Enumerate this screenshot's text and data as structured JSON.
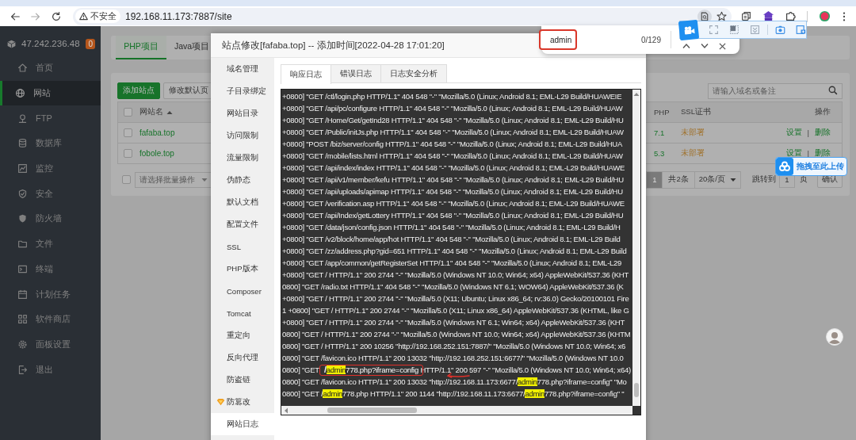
{
  "browser": {
    "security_label": "不安全",
    "url": "192.168.11.173:7887/site"
  },
  "find_bar": {
    "query": "admin",
    "annotated": true,
    "count": "0/129"
  },
  "sidebar": {
    "server": "47.242.236.48",
    "badge": "0",
    "items": [
      {
        "label": "首页",
        "selected": false
      },
      {
        "label": "网站",
        "selected": true
      },
      {
        "label": "FTP",
        "selected": false
      },
      {
        "label": "数据库",
        "selected": false
      },
      {
        "label": "监控",
        "selected": false
      },
      {
        "label": "安全",
        "selected": false
      },
      {
        "label": "防火墙",
        "selected": false
      },
      {
        "label": "文件",
        "selected": false
      },
      {
        "label": "终端",
        "selected": false
      },
      {
        "label": "计划任务",
        "selected": false
      },
      {
        "label": "软件商店",
        "selected": false
      },
      {
        "label": "面板设置",
        "selected": false
      },
      {
        "label": "退出",
        "selected": false
      }
    ]
  },
  "site_list": {
    "tabs": [
      {
        "label": "PHP项目",
        "selected": true
      },
      {
        "label": "Java项目",
        "selected": false
      }
    ],
    "buttons": [
      {
        "label": "添加站点",
        "kind": "primary"
      },
      {
        "label": "修改默认页",
        "kind": "default"
      }
    ],
    "search": {
      "placeholder": "请输入域名或备注"
    },
    "table": {
      "all_checked": false,
      "columns": [
        "网站名",
        "PHP",
        "SSL证书",
        "操作"
      ],
      "rows": [
        {
          "checked": false,
          "name": "fafaba.top",
          "php": "7.1",
          "ssl": "未部署",
          "actions": [
            "设置",
            "删除"
          ],
          "separator": "|"
        },
        {
          "checked": false,
          "name": "fobole.top",
          "php": "5.3",
          "ssl": "未部署",
          "actions": [
            "设置",
            "删除"
          ],
          "separator": "|"
        }
      ]
    },
    "batch": {
      "checked": false,
      "placeholder": "请选择批量操作"
    },
    "pagination": {
      "pages": [
        {
          "label": "1",
          "selected": true
        }
      ],
      "total": "共2条",
      "page_size": "20条/页",
      "jump_label": "跳转到",
      "jump_value": "1",
      "unit": "页",
      "confirm": "确认"
    }
  },
  "dialog": {
    "title": "站点修改[fafaba.top] -- 添加时间[2022-04-28 17:01:20]",
    "menu": [
      {
        "label": "域名管理",
        "premium": false,
        "selected": false
      },
      {
        "label": "子目录绑定",
        "premium": false,
        "selected": false
      },
      {
        "label": "网站目录",
        "premium": false,
        "selected": false
      },
      {
        "label": "访问限制",
        "premium": false,
        "selected": false
      },
      {
        "label": "流量限制",
        "premium": false,
        "selected": false
      },
      {
        "label": "伪静态",
        "premium": false,
        "selected": false
      },
      {
        "label": "默认文档",
        "premium": false,
        "selected": false
      },
      {
        "label": "配置文件",
        "premium": false,
        "selected": false
      },
      {
        "label": "SSL",
        "premium": false,
        "selected": false
      },
      {
        "label": "PHP版本",
        "premium": false,
        "selected": false
      },
      {
        "label": "Composer",
        "premium": false,
        "selected": false
      },
      {
        "label": "Tomcat",
        "premium": false,
        "selected": false
      },
      {
        "label": "重定向",
        "premium": false,
        "selected": false
      },
      {
        "label": "反向代理",
        "premium": false,
        "selected": false
      },
      {
        "label": "防盗链",
        "premium": false,
        "selected": false
      },
      {
        "label": "防篡改",
        "premium": true,
        "selected": false
      },
      {
        "label": "网站日志",
        "premium": false,
        "selected": true
      }
    ],
    "tabs": [
      {
        "label": "响应日志",
        "selected": true
      },
      {
        "label": "错误日志",
        "selected": false
      },
      {
        "label": "日志安全分析",
        "selected": false
      }
    ],
    "log_lines": [
      {
        "text": "+0800] \"GET /ctl/login.php HTTP/1.1\" 404 548 \"-\" \"Mozilla/5.0 (Linux; Android 8.1; EML-L29 Build/HUAWEIE"
      },
      {
        "text": "+0800] \"GET /api/pc/configure HTTP/1.1\" 404 548 \"-\" \"Mozilla/5.0 (Linux; Android 8.1; EML-L29 Build/HUAW"
      },
      {
        "text": "+0800] \"GET /Home/Get/getInd28 HTTP/1.1\" 404 548 \"-\" \"Mozilla/5.0 (Linux; Android 8.1; EML-L29 Build/HU"
      },
      {
        "text": "+0800] \"GET /Public/initJs.php HTTP/1.1\" 404 548 \"-\" \"Mozilla/5.0 (Linux; Android 8.1; EML-L29 Build/HUAW"
      },
      {
        "text": "+0800] \"POST /biz/server/config HTTP/1.1\" 404 548 \"-\" \"Mozilla/5.0 (Linux; Android 8.1; EML-L29 Build/HUA"
      },
      {
        "text": "+0800] \"GET /mobile/lists.html HTTP/1.1\" 404 548 \"-\" \"Mozilla/5.0 (Linux; Android 8.1; EML-L29 Build/HUAW"
      },
      {
        "text": "+0800] \"GET /api/index/index HTTP/1.1\" 404 548 \"-\" \"Mozilla/5.0 (Linux; Android 8.1; EML-L29 Build/HUAWE"
      },
      {
        "text": "+0800] \"GET /api/v1/member/kefu HTTP/1.1\" 404 548 \"-\" \"Mozilla/5.0 (Linux; Android 8.1; EML-L29 Build/HU"
      },
      {
        "text": "+0800] \"GET /api/uploads/apimap HTTP/1.1\" 404 548 \"-\" \"Mozilla/5.0 (Linux; Android 8.1; EML-L29 Build/HU"
      },
      {
        "text": "+0800] \"GET /verification.asp HTTP/1.1\" 404 548 \"-\" \"Mozilla/5.0 (Linux; Android 8.1; EML-L29 Build/HUAWE"
      },
      {
        "text": "+0800] \"GET /api/Index/getLottery HTTP/1.1\" 404 548 \"-\" \"Mozilla/5.0 (Linux; Android 8.1; EML-L29 Build/HU"
      },
      {
        "text": "+0800] \"GET /data/json/config.json HTTP/1.1\" 404 548 \"-\" \"Mozilla/5.0 (Linux; Android 8.1; EML-L29 Build/H"
      },
      {
        "text": "+0800] \"GET /v2/block/home/app/hot HTTP/1.1\" 404 548 \"-\" \"Mozilla/5.0 (Linux; Android 8.1; EML-L29 Build"
      },
      {
        "text": "+0800] \"GET /zz/address.php?gid=651 HTTP/1.1\" 404 548 \"-\" \"Mozilla/5.0 (Linux; Android 8.1; EML-L29 Build"
      },
      {
        "text": "+0800] \"GET /app/common/getRegisterSet HTTP/1.1\" 404 548 \"-\" \"Mozilla/5.0 (Linux; Android 8.1; EML-L29"
      },
      {
        "text": "+0800] \"GET / HTTP/1.1\" 200 2744 \"-\" \"Mozilla/5.0 (Windows NT 10.0; Win64; x64) AppleWebKit/537.36 (KHT"
      },
      {
        "text": "0800] \"GET /radio.txt HTTP/1.1\" 404 548 \"-\" \"Mozilla/5.0 (Windows NT 6.1; WOW64) AppleWebKit/537.36 (K"
      },
      {
        "text": "+0800] \"GET / HTTP/1.1\" 200 2744 \"-\" \"Mozilla/5.0 (X11; Ubuntu; Linux x86_64; rv:36.0) Gecko/20100101 Fire"
      },
      {
        "text": "1 +0800] \"GET / HTTP/1.1\" 200 2744 \"-\" \"Mozilla/5.0 (X11; Linux x86_64) AppleWebKit/537.36 (KHTML, like G"
      },
      {
        "text": "+0800] \"GET / HTTP/1.1\" 200 2744 \"-\" \"Mozilla/5.0 (Windows NT 6.1; Win64; x64) AppleWebKit/537.36 (KHT"
      },
      {
        "text": "0800] \"GET / HTTP/1.1\" 200 2744 \"-\" \"Mozilla/5.0 (Windows NT 10.0; Win64; x64) AppleWebKit/537.36 (KHTM"
      },
      {
        "text": "0800] \"GET / HTTP/1.1\" 200 10256 \"http://192.168.252.151:7887/\" \"Mozilla/5.0 (Windows NT 10.0; Win64; x6"
      },
      {
        "text": "0800] \"GET /favicon.ico HTTP/1.1\" 200 13032 \"http://192.168.252.151:6677/\" \"Mozilla/5.0 (Windows NT 10.0"
      },
      {
        "arrow": true,
        "segments": [
          {
            "text": "0800] \"GET ",
            "highlighted": false
          },
          {
            "framed": true,
            "parts": [
              {
                "text": "/",
                "highlighted": false
              },
              {
                "text": "admin",
                "highlighted": true
              },
              {
                "text": "778.php?iframe=config",
                "highlighted": false
              }
            ]
          },
          {
            "text": " HTTP/1.1\" 200 597 \"-\" \"Mozilla/5.0 (Windows NT 10.0; Win64; x64)",
            "highlighted": false
          }
        ]
      },
      {
        "segments": [
          {
            "text": "0800] \"GET /favicon.ico HTTP/1.1\" 200 13032 \"http://192.168.11.173:6677/",
            "highlighted": false
          },
          {
            "text": "admin",
            "highlighted": true
          },
          {
            "text": "778.php?iframe=config\" \"Mo",
            "highlighted": false
          }
        ]
      },
      {
        "segments": [
          {
            "text": "0800] \"GET /",
            "highlighted": false
          },
          {
            "text": "admin",
            "highlighted": true
          },
          {
            "text": "778.php HTTP/1.1\" 200 1144 \"http://192.168.11.173:6677/",
            "highlighted": false
          },
          {
            "text": "admin",
            "highlighted": true
          },
          {
            "text": "778.php?iframe=config\" \"",
            "highlighted": false
          }
        ]
      }
    ]
  },
  "upload_button": {
    "label": "拖拽至此上传"
  }
}
